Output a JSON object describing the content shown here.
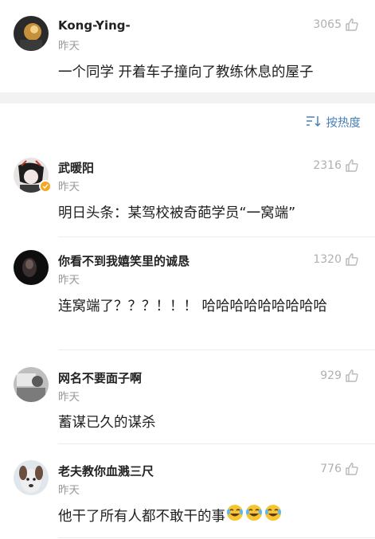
{
  "top_comment": {
    "username": "Kong-Ying-",
    "time": "昨天",
    "likes": "3065",
    "text": "一个同学 开着车子撞向了教练休息的屋子"
  },
  "sort": {
    "label": "按热度",
    "icon": "sort-icon"
  },
  "comments": [
    {
      "username": "武暖阳",
      "time": "昨天",
      "likes": "2316",
      "text": "明日头条：某驾校被奇葩学员“一窝端”",
      "verified": true
    },
    {
      "username": "你看不到我嬉笑里的诚恳",
      "time": "昨天",
      "likes": "1320",
      "text": "连窝端了？？？！！！ 哈哈哈哈哈哈哈哈哈"
    },
    {
      "username": "网名不要面子啊",
      "time": "昨天",
      "likes": "929",
      "text": "蓄谋已久的谋杀"
    },
    {
      "username": "老夫教你血溅三尺",
      "time": "昨天",
      "likes": "776",
      "text": "他干了所有人都不敢干的事",
      "emoji": [
        "laugh-cry-emoji",
        "laugh-cry-emoji",
        "laugh-cry-emoji"
      ]
    }
  ],
  "colors": {
    "accent": "#4a7fb6",
    "muted": "#9a9a9a",
    "separator": "#f2f2f2"
  }
}
